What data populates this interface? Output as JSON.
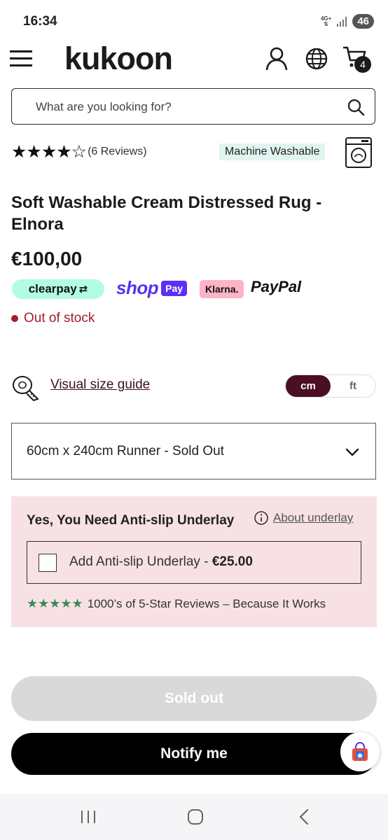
{
  "status_bar": {
    "time": "16:34",
    "network": "4G+",
    "battery": "46"
  },
  "header": {
    "logo": "kukoon",
    "cart_count": "4"
  },
  "search": {
    "placeholder": "What are you looking for?"
  },
  "rating": {
    "stars": "★★★★☆",
    "reviews": "(6 Reviews)",
    "value": 4.5,
    "max": 5
  },
  "badge": {
    "machine_washable": "Machine Washable"
  },
  "product": {
    "title": "Soft Washable Cream Distressed Rug - Elnora",
    "price": "€100,00",
    "stock": "Out of stock"
  },
  "payments": {
    "clearpay": "clearpay",
    "shop": "shop",
    "shop_pay": "Pay",
    "klarna": "Klarna.",
    "paypal": "PayPal"
  },
  "size_guide": {
    "label": "Visual size guide",
    "units": [
      "cm",
      "ft"
    ],
    "active_unit": "cm"
  },
  "size_select": {
    "value": "60cm x 240cm Runner - Sold Out"
  },
  "underlay": {
    "title": "Yes, You Need Anti-slip Underlay",
    "about": "About underlay",
    "checkbox_label": "Add Anti-slip Underlay - ",
    "checkbox_price": "€25.00",
    "review_stars": "★★★★★",
    "reviews_text": "1000’s of 5-Star Reviews – Because It Works"
  },
  "buttons": {
    "sold_out": "Sold out",
    "notify": "Notify me"
  },
  "colors": {
    "brand_dark": "#4a0f21",
    "out_of_stock": "#a51d2d",
    "underlay_bg": "#f7e1e4",
    "washable_bg": "#e2f4f0",
    "shop_purple": "#5a31f4",
    "star_green": "#3b8a5a"
  }
}
